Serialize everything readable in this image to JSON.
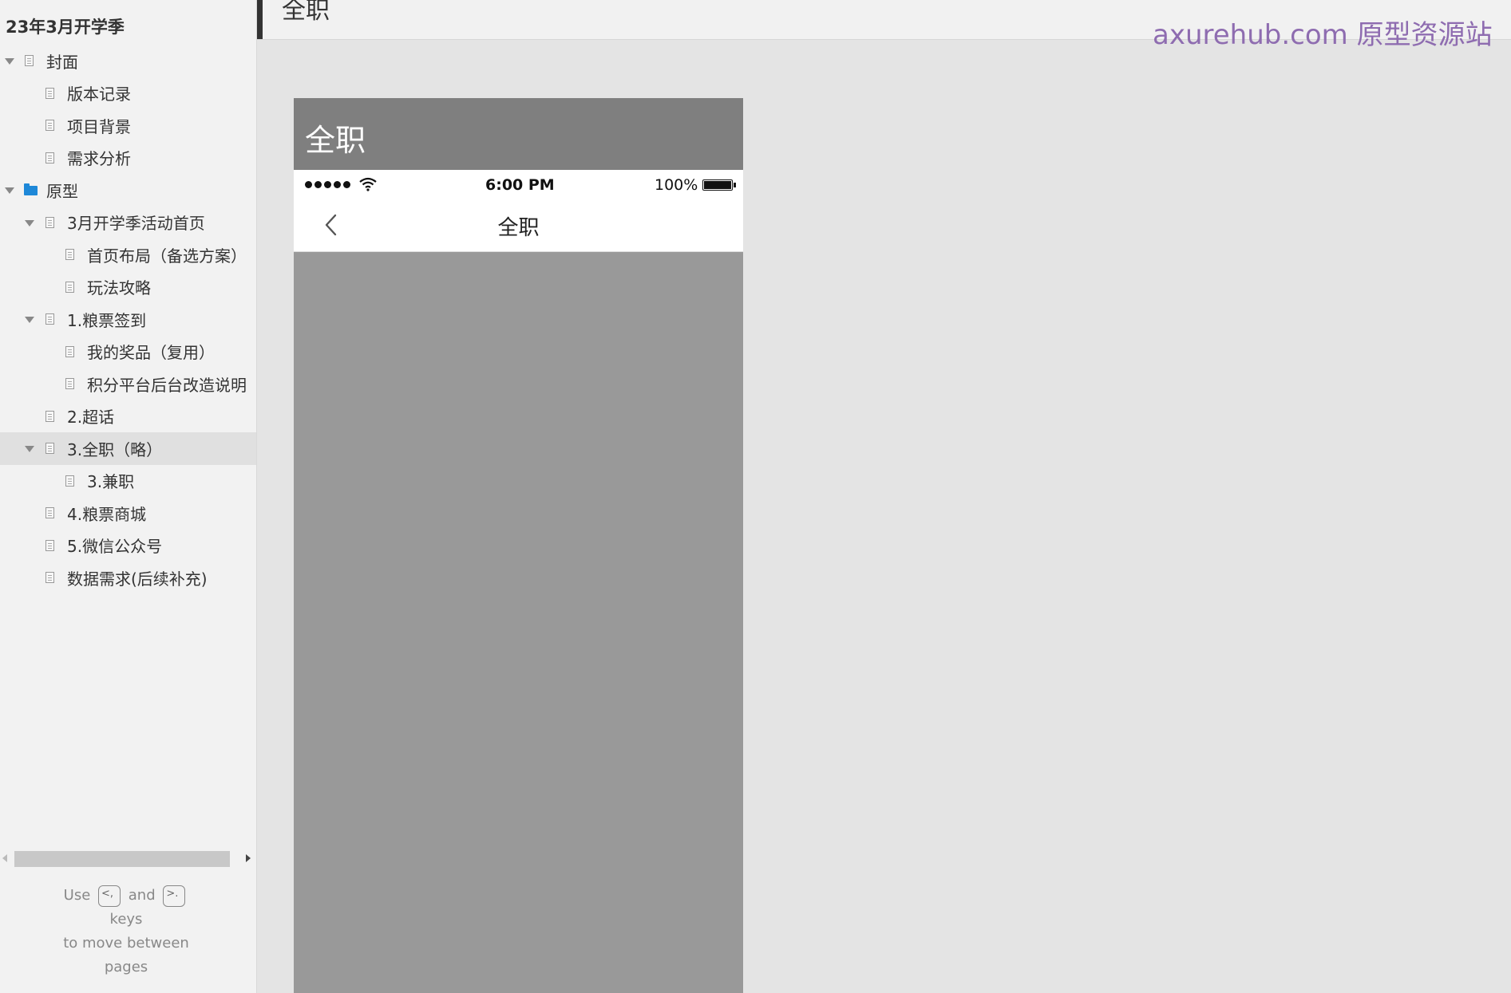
{
  "sidebar": {
    "project_title": "23年3月开学季",
    "items": [
      {
        "label": "封面",
        "type": "page",
        "expandable": true
      },
      {
        "label": "版本记录",
        "type": "page"
      },
      {
        "label": "项目背景",
        "type": "page"
      },
      {
        "label": "需求分析",
        "type": "page"
      },
      {
        "label": "原型",
        "type": "folder",
        "expandable": true
      },
      {
        "label": "3月开学季活动首页",
        "type": "page",
        "expandable": true
      },
      {
        "label": "首页布局（备选方案）",
        "type": "page"
      },
      {
        "label": "玩法攻略",
        "type": "page"
      },
      {
        "label": "1.粮票签到",
        "type": "page",
        "expandable": true
      },
      {
        "label": "我的奖品（复用）",
        "type": "page"
      },
      {
        "label": "积分平台后台改造说明",
        "type": "page"
      },
      {
        "label": "2.超话",
        "type": "page"
      },
      {
        "label": "3.全职（略）",
        "type": "page",
        "expandable": true,
        "selected": true
      },
      {
        "label": "3.兼职",
        "type": "page"
      },
      {
        "label": "4.粮票商城",
        "type": "page"
      },
      {
        "label": "5.微信公众号",
        "type": "page"
      },
      {
        "label": "数据需求(后续补充)",
        "type": "page"
      }
    ],
    "hint": {
      "use": "Use",
      "prev_key": "<,",
      "and": "and",
      "next_key": ">.",
      "keys": "keys",
      "line2": "to move between",
      "line3": "pages"
    }
  },
  "header": {
    "page_heading": "全职",
    "watermark": "axurehub.com 原型资源站"
  },
  "phone": {
    "banner_title": "全职",
    "status_time": "6:00 PM",
    "battery_percent": "100%",
    "battery_level": 1.0,
    "nav_title": "全职"
  },
  "colors": {
    "canvas_bg": "#e4e4e4",
    "sidebar_bg": "#f2f2f2",
    "phone_body": "#999999",
    "phone_banner": "#7f7f7f",
    "watermark": "#8e6cb0",
    "folder_icon": "#1e88d8"
  }
}
